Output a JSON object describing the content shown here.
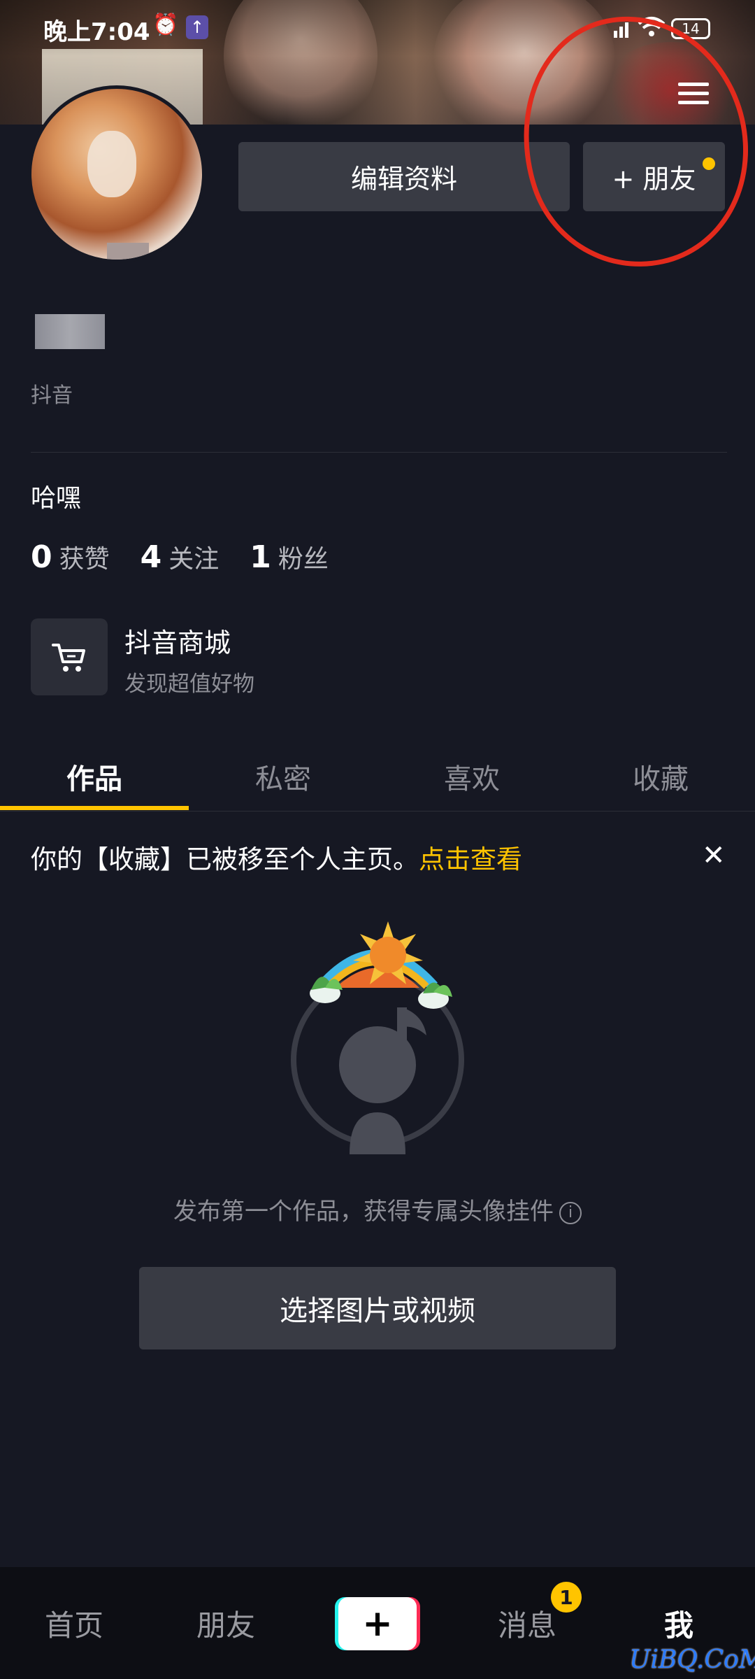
{
  "status_bar": {
    "time": "晚上7:04",
    "battery": "14",
    "icons": [
      "alarm-icon",
      "upload-icon",
      "signal-icon",
      "wifi-icon",
      "battery-icon"
    ]
  },
  "profile": {
    "edit_button": "编辑资料",
    "friends_button": "+ 朋友",
    "account_label": "抖音",
    "bio": "哈嘿",
    "stats": [
      {
        "value": "0",
        "label": "获赞"
      },
      {
        "value": "4",
        "label": "关注"
      },
      {
        "value": "1",
        "label": "粉丝"
      }
    ]
  },
  "mall": {
    "title": "抖音商城",
    "subtitle": "发现超值好物",
    "icon": "cart-icon"
  },
  "tabs": {
    "items": [
      "作品",
      "私密",
      "喜欢",
      "收藏"
    ],
    "active": "作品"
  },
  "notice": {
    "text": "你的【收藏】已被移至个人主页。",
    "link": "点击查看"
  },
  "empty_state": {
    "hint": "发布第一个作品，获得专属头像挂件",
    "button": "选择图片或视频"
  },
  "bottom_nav": {
    "items": [
      "首页",
      "朋友",
      "消息",
      "我"
    ],
    "active": "我",
    "message_badge": "1",
    "create_icon": "plus-icon"
  },
  "watermark": "UiBQ.CoM",
  "colors": {
    "background": "#161823",
    "accent": "#ffc400",
    "button": "#393b44",
    "annotation": "#e32a1c"
  }
}
